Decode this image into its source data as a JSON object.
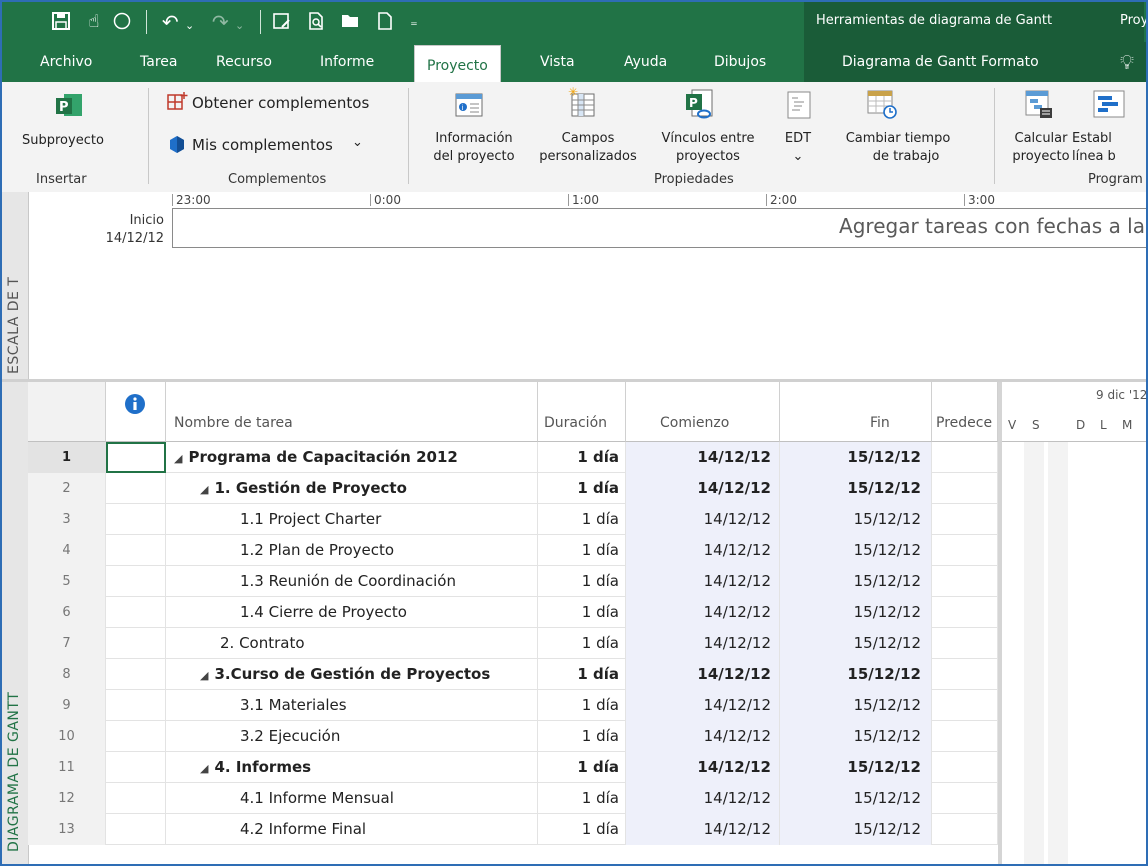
{
  "qat": {
    "icons": [
      "save-icon",
      "touch-mode-icon",
      "circle-icon",
      "undo-icon",
      "redo-icon",
      "gantt-view-icon",
      "print-preview-icon",
      "open-folder-icon",
      "new-file-icon",
      "customize-icon"
    ]
  },
  "context": {
    "title": "Herramientas de diagrama de Gantt",
    "app": "Proy"
  },
  "tabs": {
    "archivo": "Archivo",
    "tarea": "Tarea",
    "recurso": "Recurso",
    "informe": "Informe",
    "proyecto": "Proyecto",
    "vista": "Vista",
    "ayuda": "Ayuda",
    "dibujos": "Dibujos",
    "formato": "Diagrama de Gantt Formato"
  },
  "ribbon": {
    "subproyecto": "Subproyecto",
    "obtener": "Obtener complementos",
    "mis": "Mis complementos",
    "mis_caret": "⌄",
    "info_1": "Información",
    "info_2": "del proyecto",
    "campos_1": "Campos",
    "campos_2": "personalizados",
    "vinculos_1": "Vínculos entre",
    "vinculos_2": "proyectos",
    "edt": "EDT",
    "edt_caret": "⌄",
    "cambiar_1": "Cambiar tiempo",
    "cambiar_2": "de trabajo",
    "calcular_1": "Calcular",
    "calcular_2": "proyecto",
    "establecer_1": "Establ",
    "establecer_2": "línea b",
    "groups": {
      "insertar": "Insertar",
      "complementos": "Complementos",
      "propiedades": "Propiedades",
      "programar": "Program"
    }
  },
  "timeline": {
    "side_label": "ESCALA DE T",
    "ticks": [
      "23:00",
      "0:00",
      "1:00",
      "2:00",
      "3:00"
    ],
    "start_label": "Inicio",
    "start_date": "14/12/12",
    "placeholder": "Agregar tareas con fechas a la"
  },
  "grid": {
    "side_label": "DIAGRAMA DE GANTT",
    "headers": {
      "info": "i",
      "name": "Nombre de tarea",
      "duration": "Duración",
      "start": "Comienzo",
      "end": "Fin",
      "pred": "Predece"
    },
    "rows": [
      {
        "id": "1",
        "name": "Programa de Capacitación 2012",
        "duration": "1 día",
        "start": "14/12/12",
        "end": "15/12/12"
      },
      {
        "id": "2",
        "name": "1. Gestión de Proyecto",
        "duration": "1 día",
        "start": "14/12/12",
        "end": "15/12/12"
      },
      {
        "id": "3",
        "name": "1.1 Project Charter",
        "duration": "1 día",
        "start": "14/12/12",
        "end": "15/12/12"
      },
      {
        "id": "4",
        "name": "1.2 Plan de Proyecto",
        "duration": "1 día",
        "start": "14/12/12",
        "end": "15/12/12"
      },
      {
        "id": "5",
        "name": "1.3 Reunión de Coordinación",
        "duration": "1 día",
        "start": "14/12/12",
        "end": "15/12/12"
      },
      {
        "id": "6",
        "name": "1.4 Cierre de Proyecto",
        "duration": "1 día",
        "start": "14/12/12",
        "end": "15/12/12"
      },
      {
        "id": "7",
        "name": "2. Contrato",
        "duration": "1 día",
        "start": "14/12/12",
        "end": "15/12/12"
      },
      {
        "id": "8",
        "name": "3.Curso de Gestión de Proyectos",
        "duration": "1 día",
        "start": "14/12/12",
        "end": "15/12/12"
      },
      {
        "id": "9",
        "name": "3.1 Materiales",
        "duration": "1 día",
        "start": "14/12/12",
        "end": "15/12/12"
      },
      {
        "id": "10",
        "name": "3.2 Ejecución",
        "duration": "1 día",
        "start": "14/12/12",
        "end": "15/12/12"
      },
      {
        "id": "11",
        "name": "4. Informes",
        "duration": "1 día",
        "start": "14/12/12",
        "end": "15/12/12"
      },
      {
        "id": "12",
        "name": "4.1 Informe  Mensual",
        "duration": "1 día",
        "start": "14/12/12",
        "end": "15/12/12"
      },
      {
        "id": "13",
        "name": "4.2 Informe Final",
        "duration": "1 día",
        "start": "14/12/12",
        "end": "15/12/12"
      }
    ]
  },
  "gantt": {
    "week": "9 dic '12",
    "days": [
      "V",
      "S",
      "D",
      "L",
      "M"
    ]
  },
  "colors": {
    "accent": "#217346",
    "context": "#1a5c38",
    "frame": "#2e6db5"
  }
}
